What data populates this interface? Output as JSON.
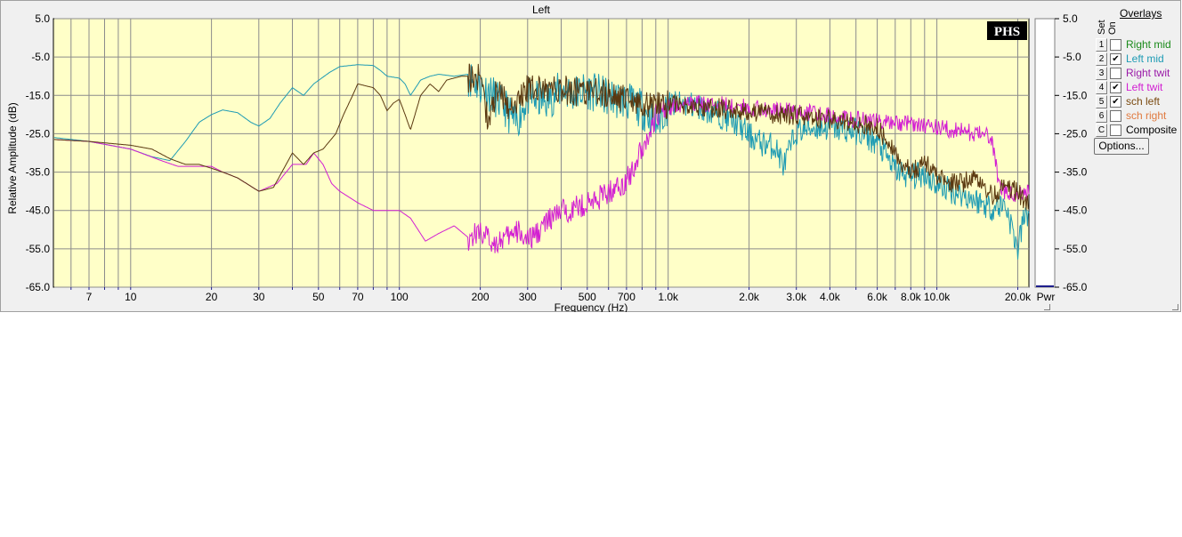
{
  "window": {
    "title": "Left"
  },
  "chart_data": {
    "type": "line",
    "title": "Left",
    "xlabel": "Frequency (Hz)",
    "ylabel": "Relative Amplitude (dB)",
    "xscale": "log",
    "xlim": [
      5.2,
      22000
    ],
    "ylim": [
      -65,
      5
    ],
    "x_tick_labels": [
      {
        "v": 7,
        "t": "7"
      },
      {
        "v": 10,
        "t": "10"
      },
      {
        "v": 20,
        "t": "20"
      },
      {
        "v": 30,
        "t": "30"
      },
      {
        "v": 50,
        "t": "50"
      },
      {
        "v": 70,
        "t": "70"
      },
      {
        "v": 100,
        "t": "100"
      },
      {
        "v": 200,
        "t": "200"
      },
      {
        "v": 300,
        "t": "300"
      },
      {
        "v": 500,
        "t": "500"
      },
      {
        "v": 700,
        "t": "700"
      },
      {
        "v": 1000,
        "t": "1.0k"
      },
      {
        "v": 2000,
        "t": "2.0k"
      },
      {
        "v": 3000,
        "t": "3.0k"
      },
      {
        "v": 4000,
        "t": "4.0k"
      },
      {
        "v": 6000,
        "t": "6.0k"
      },
      {
        "v": 8000,
        "t": "8.0k"
      },
      {
        "v": 10000,
        "t": "10.0k"
      },
      {
        "v": 20000,
        "t": "20.0k"
      }
    ],
    "y_tick_labels": [
      "5.0",
      "-5.0",
      "-15.0",
      "-25.0",
      "-35.0",
      "-45.0",
      "-55.0",
      "-65.0"
    ],
    "y_ticks": [
      5,
      -5,
      -15,
      -25,
      -35,
      -45,
      -55,
      -65
    ],
    "grid": true,
    "logo": "PHS",
    "pwr_label": "Pwr",
    "series": [
      {
        "name": "Left mid",
        "color": "#1e9bb4",
        "points": [
          [
            5.2,
            -26
          ],
          [
            7,
            -27
          ],
          [
            10,
            -29
          ],
          [
            12,
            -31
          ],
          [
            14,
            -32
          ],
          [
            16,
            -27
          ],
          [
            18,
            -22
          ],
          [
            20,
            -20
          ],
          [
            22,
            -18.8
          ],
          [
            25,
            -19.5
          ],
          [
            28,
            -22
          ],
          [
            30,
            -23
          ],
          [
            33,
            -21
          ],
          [
            36,
            -17
          ],
          [
            40,
            -13
          ],
          [
            44,
            -15
          ],
          [
            48,
            -12
          ],
          [
            55,
            -9
          ],
          [
            60,
            -7.5
          ],
          [
            70,
            -7
          ],
          [
            80,
            -7.2
          ],
          [
            85,
            -8.5
          ],
          [
            90,
            -10
          ],
          [
            100,
            -10.5
          ],
          [
            105,
            -12
          ],
          [
            110,
            -15
          ],
          [
            120,
            -11
          ],
          [
            130,
            -10
          ],
          [
            140,
            -9.5
          ],
          [
            160,
            -10
          ],
          [
            180,
            -9.5
          ],
          [
            200,
            -12
          ],
          [
            220,
            -14
          ],
          [
            250,
            -18
          ],
          [
            270,
            -22
          ],
          [
            300,
            -15
          ],
          [
            350,
            -16
          ],
          [
            400,
            -13
          ],
          [
            450,
            -14
          ],
          [
            500,
            -13
          ],
          [
            600,
            -15
          ],
          [
            700,
            -16
          ],
          [
            800,
            -18
          ],
          [
            900,
            -22
          ],
          [
            1000,
            -17
          ],
          [
            1200,
            -17
          ],
          [
            1500,
            -19
          ],
          [
            1800,
            -22
          ],
          [
            2000,
            -25
          ],
          [
            2200,
            -27
          ],
          [
            2500,
            -28
          ],
          [
            2700,
            -33
          ],
          [
            3000,
            -24
          ],
          [
            3500,
            -23
          ],
          [
            4000,
            -23
          ],
          [
            5000,
            -24
          ],
          [
            6000,
            -27
          ],
          [
            7000,
            -34
          ],
          [
            8000,
            -36
          ],
          [
            9000,
            -35
          ],
          [
            10000,
            -38
          ],
          [
            12000,
            -40
          ],
          [
            14000,
            -42
          ],
          [
            16000,
            -44
          ],
          [
            18000,
            -43
          ],
          [
            20000,
            -55
          ],
          [
            21000,
            -47
          ],
          [
            22000,
            -45
          ]
        ],
        "jitter": 4
      },
      {
        "name": "Left twit",
        "color": "#d21ed2",
        "points": [
          [
            5.2,
            -26.5
          ],
          [
            7,
            -27
          ],
          [
            10,
            -29
          ],
          [
            13,
            -32
          ],
          [
            15,
            -33.5
          ],
          [
            20,
            -33.5
          ],
          [
            22,
            -35
          ],
          [
            25,
            -36.5
          ],
          [
            30,
            -40
          ],
          [
            35,
            -38
          ],
          [
            40,
            -33
          ],
          [
            45,
            -33
          ],
          [
            48,
            -30
          ],
          [
            52,
            -33
          ],
          [
            56,
            -38
          ],
          [
            60,
            -40
          ],
          [
            70,
            -43
          ],
          [
            80,
            -45
          ],
          [
            90,
            -45
          ],
          [
            100,
            -45
          ],
          [
            110,
            -47
          ],
          [
            125,
            -53
          ],
          [
            140,
            -51
          ],
          [
            160,
            -49
          ],
          [
            180,
            -52
          ],
          [
            200,
            -50
          ],
          [
            220,
            -53
          ],
          [
            250,
            -52
          ],
          [
            280,
            -50
          ],
          [
            300,
            -53
          ],
          [
            350,
            -48
          ],
          [
            400,
            -45
          ],
          [
            500,
            -43
          ],
          [
            600,
            -40
          ],
          [
            700,
            -37
          ],
          [
            750,
            -33
          ],
          [
            800,
            -28
          ],
          [
            850,
            -25
          ],
          [
            900,
            -20
          ],
          [
            1000,
            -18
          ],
          [
            1200,
            -17
          ],
          [
            1500,
            -17
          ],
          [
            2000,
            -18
          ],
          [
            3000,
            -19
          ],
          [
            4000,
            -20
          ],
          [
            5000,
            -21
          ],
          [
            6000,
            -21.5
          ],
          [
            8000,
            -22
          ],
          [
            10000,
            -23
          ],
          [
            12000,
            -24
          ],
          [
            15000,
            -25
          ],
          [
            16000,
            -26
          ],
          [
            17000,
            -38
          ],
          [
            18000,
            -40
          ],
          [
            20000,
            -41
          ],
          [
            22000,
            -40
          ]
        ],
        "jitter": 2.5
      },
      {
        "name": "sch left",
        "color": "#5a3810",
        "points": [
          [
            5.2,
            -26.5
          ],
          [
            7,
            -27
          ],
          [
            10,
            -28
          ],
          [
            12,
            -29
          ],
          [
            14,
            -31.5
          ],
          [
            16,
            -33
          ],
          [
            18,
            -33
          ],
          [
            20,
            -34
          ],
          [
            22,
            -35
          ],
          [
            25,
            -36.5
          ],
          [
            30,
            -40
          ],
          [
            34,
            -39
          ],
          [
            40,
            -30
          ],
          [
            44,
            -33
          ],
          [
            48,
            -30
          ],
          [
            52,
            -29
          ],
          [
            58,
            -25
          ],
          [
            62,
            -20
          ],
          [
            67,
            -15
          ],
          [
            70,
            -12
          ],
          [
            80,
            -13
          ],
          [
            85,
            -15
          ],
          [
            90,
            -19
          ],
          [
            95,
            -17
          ],
          [
            100,
            -16
          ],
          [
            105,
            -20
          ],
          [
            110,
            -24
          ],
          [
            120,
            -15
          ],
          [
            130,
            -12
          ],
          [
            140,
            -14
          ],
          [
            150,
            -11
          ],
          [
            170,
            -10
          ],
          [
            200,
            -10
          ],
          [
            215,
            -22
          ],
          [
            230,
            -13
          ],
          [
            260,
            -18
          ],
          [
            300,
            -13
          ],
          [
            400,
            -13
          ],
          [
            500,
            -14
          ],
          [
            600,
            -14
          ],
          [
            700,
            -16
          ],
          [
            800,
            -17
          ],
          [
            1000,
            -17
          ],
          [
            1500,
            -18
          ],
          [
            2000,
            -19
          ],
          [
            3000,
            -20
          ],
          [
            4000,
            -21
          ],
          [
            5000,
            -22
          ],
          [
            6000,
            -23
          ],
          [
            7000,
            -30
          ],
          [
            8000,
            -35
          ],
          [
            9000,
            -32
          ],
          [
            10000,
            -36
          ],
          [
            12000,
            -38
          ],
          [
            14000,
            -36
          ],
          [
            16000,
            -41
          ],
          [
            18000,
            -38
          ],
          [
            20000,
            -40
          ],
          [
            22000,
            -43
          ]
        ],
        "jitter": 3
      }
    ]
  },
  "overlays": {
    "title": "Overlays",
    "col_set": "Set",
    "col_on": "On",
    "items": [
      {
        "key": "1",
        "label": "Right mid",
        "checked": false,
        "color": "#1a8a1a"
      },
      {
        "key": "2",
        "label": "Left mid",
        "checked": true,
        "color": "#1e9bb4"
      },
      {
        "key": "3",
        "label": "Right twit",
        "checked": false,
        "color": "#9a1aa8"
      },
      {
        "key": "4",
        "label": "Left twit",
        "checked": true,
        "color": "#d21ed2"
      },
      {
        "key": "5",
        "label": "sch left",
        "checked": true,
        "color": "#7a4a10"
      },
      {
        "key": "6",
        "label": "sch right",
        "checked": false,
        "color": "#e07a40"
      },
      {
        "key": "C",
        "label": "Composite",
        "checked": false,
        "color": "#000000"
      }
    ],
    "options_label": "Options..."
  }
}
